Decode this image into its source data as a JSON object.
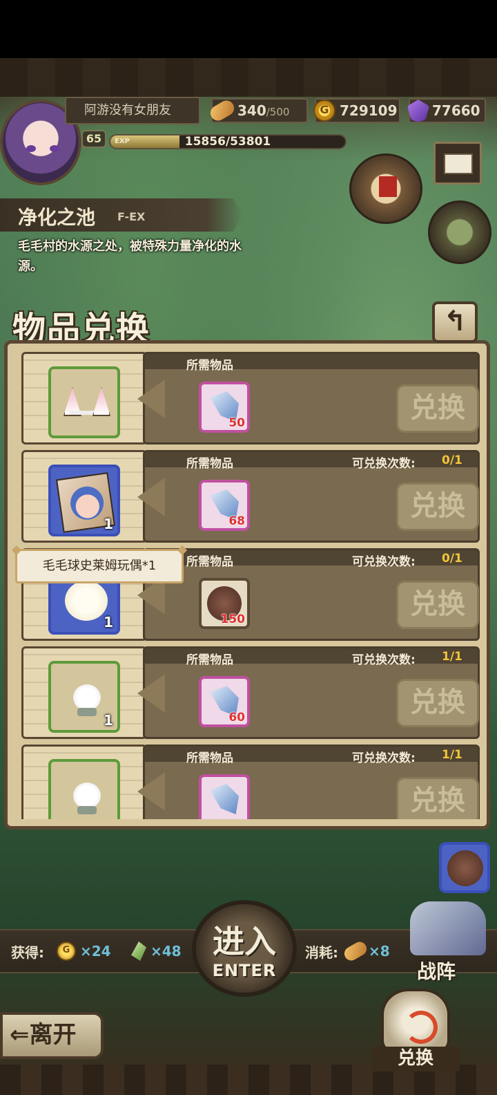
{
  "player": {
    "name": "阿游没有女朋友",
    "level": "65",
    "exp_label": "EXP",
    "exp_text": "15856/53801",
    "exp_fraction": 0.2947
  },
  "resources": {
    "stamina_current": "340",
    "stamina_max": "/500",
    "gold": "729109",
    "gems": "77660"
  },
  "stage": {
    "name": "净化之池",
    "difficulty": "F-EX",
    "description": "毛毛村的水源之处，被特殊力量净化的水源。"
  },
  "dialog": {
    "title": "物品兑换",
    "back_icon": "↰",
    "req_label": "所需物品",
    "count_label": "可兑换次数:",
    "exchange_label": "兑换",
    "rows": [
      {
        "reward_icon": "cat-ear-headband-icon",
        "reward_qty": "",
        "req_icon": "blue-feather-icon",
        "req_qty": "50",
        "count": ""
      },
      {
        "reward_icon": "character-card-icon",
        "reward_qty": "1",
        "req_icon": "blue-feather-icon",
        "req_qty": "68",
        "count": "0/1"
      },
      {
        "reward_icon": "fluffy-slime-plush-icon",
        "reward_qty": "1",
        "req_icon": "fur-ball-icon",
        "req_qty": "150",
        "count": "0/1"
      },
      {
        "reward_icon": "small-fluff-figure-icon",
        "reward_qty": "1",
        "req_icon": "blue-feather-icon",
        "req_qty": "60",
        "count": "1/1"
      },
      {
        "reward_icon": "fluff-figure-icon",
        "reward_qty": "",
        "req_icon": "pink-fluff-icon",
        "req_qty": "",
        "count": "1/1"
      }
    ],
    "tooltip": "毛毛球史莱姆玩偶*1"
  },
  "bottom": {
    "gain_label": "获得:",
    "gain_gold": "×24",
    "gain_feather": "×48",
    "cost_label": "消耗:",
    "cost_stamina": "×8",
    "enter_cn": "进入",
    "enter_en": "ENTER",
    "formation_label": "战阵",
    "leave_label": "⇐离开",
    "exchange_label": "兑换",
    "coin_glyph": "G"
  }
}
